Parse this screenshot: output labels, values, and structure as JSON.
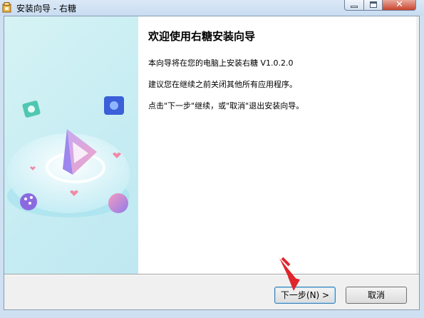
{
  "window": {
    "title": "安装向导 - 右糖",
    "close_glyph": "✕"
  },
  "content": {
    "heading": "欢迎使用右糖安装向导",
    "line1": "本向导将在您的电脑上安装右糖 V1.0.2.0",
    "line2": "建议您在继续之前关闭其他所有应用程序。",
    "line3": "点击\"下一步\"继续，或\"取消\"退出安装向导。"
  },
  "buttons": {
    "next": "下一步(N) >",
    "cancel": "取消"
  },
  "colors": {
    "annotation_arrow": "#e0262c",
    "panel_gradient": "#c9eef3"
  }
}
